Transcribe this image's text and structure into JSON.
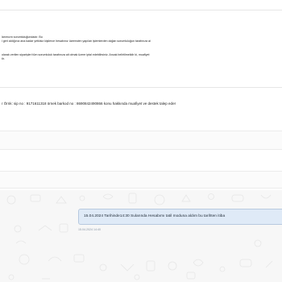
{
  "notice": {
    "line1": "larımızın sorumluluğundadır. Bu",
    "line2": "i geri aldığınız ana kadar yetkisiz kişilerce hesabınız üzerinden yapılan işlemlerden doğan sorumluluğun tarafınıza ai",
    "line3": "olarak verilen siparişleri tüm sorumluluk tarafınıza ait olmak üzere iptal edebilirsiniz. Ancak belirtilmelidir ki, muafiyet",
    "line4": "tir."
  },
  "example_text": "r   Örnk: sip no : 9171611318 örnek barkod no : 8690842490866 konu hakkında muafiyet ve destek talep eder",
  "message": {
    "text": "15.04.2024 Tarihinde14:30 Sularında Hesabımı tatil moduna aldım bu tarihten itiba",
    "time": "15.04.2024 14:40"
  }
}
